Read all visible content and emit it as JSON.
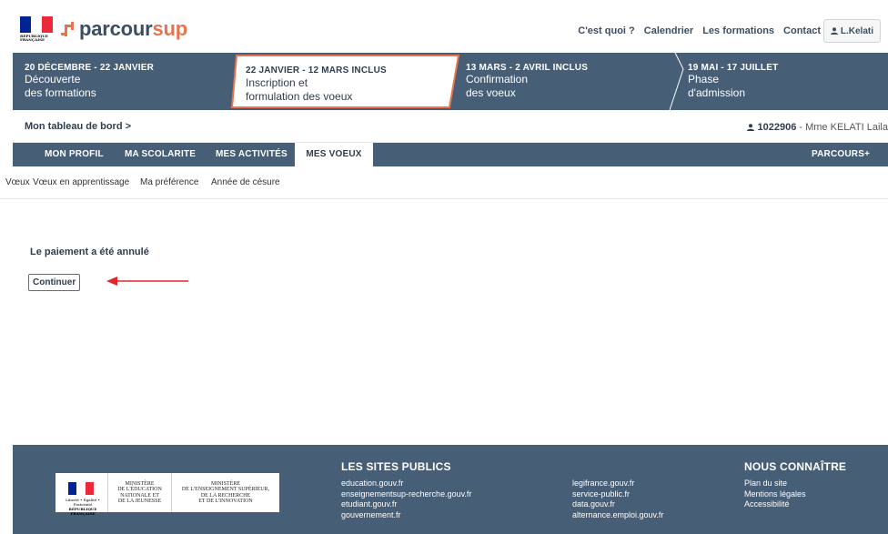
{
  "header": {
    "marianne_republic": "RÉPUBLIQUE FRANÇAISE",
    "marianne_motto": "Liberté • Égalité • Fraternité",
    "logo_part1": "parcour",
    "logo_part2": "sup",
    "nav": [
      "C'est quoi ?",
      "Calendrier",
      "Les formations",
      "Contact"
    ],
    "user_button": "L.Kelati"
  },
  "timeline": [
    {
      "date": "20 DÉCEMBRE - 22 JANVIER",
      "name_line1": "Découverte",
      "name_line2": "des formations",
      "active": false
    },
    {
      "date": "22 JANVIER - 12 MARS INCLUS",
      "name_line1": "Inscription et",
      "name_line2": "formulation des voeux",
      "active": true
    },
    {
      "date": "13 MARS - 2 AVRIL INCLUS",
      "name_line1": "Confirmation",
      "name_line2": "des voeux",
      "active": false
    },
    {
      "date": "19 MAI - 17 JUILLET",
      "name_line1": "Phase",
      "name_line2": "d'admission",
      "active": false
    }
  ],
  "breadcrumb": "Mon tableau de bord >",
  "user_info": {
    "id": "1022906",
    "name": " - Mme KELATI Laila"
  },
  "main_nav": [
    "MON PROFIL",
    "MA SCOLARITE",
    "MES ACTIVITÉS",
    "MES VOEUX"
  ],
  "main_nav_right": "PARCOURS+",
  "sub_nav": [
    "Vœux",
    "Vœux en apprentissage",
    "Ma préférence",
    "Année de césure"
  ],
  "content": {
    "message": "Le paiement a été annulé",
    "continue_button": "Continuer"
  },
  "footer": {
    "ministry1": [
      "MINISTÈRE",
      "DE L'ÉDUCATION",
      "NATIONALE ET",
      "DE LA JEUNESSE"
    ],
    "ministry2": [
      "MINISTÈRE",
      "DE L'ENSEIGNEMENT SUPÉRIEUR,",
      "DE LA RECHERCHE",
      "ET DE L'INNOVATION"
    ],
    "sites_title": "LES SITES PUBLICS",
    "sites_col1": [
      "education.gouv.fr",
      "enseignementsup-recherche.gouv.fr",
      "etudiant.gouv.fr",
      "gouvernement.fr"
    ],
    "sites_col2": [
      "legifrance.gouv.fr",
      "service-public.fr",
      "data.gouv.fr",
      "alternance.emploi.gouv.fr"
    ],
    "know_title": "NOUS CONNAÎTRE",
    "know_links": [
      "Plan du site",
      "Mentions légales",
      "Accessibilité"
    ]
  },
  "colors": {
    "navy": "#465e76",
    "orange": "#e8734f",
    "text_dark": "#2f3d4d",
    "flag_blue": "#002395",
    "flag_red": "#ed2939",
    "arrow_red": "#e3242b"
  }
}
